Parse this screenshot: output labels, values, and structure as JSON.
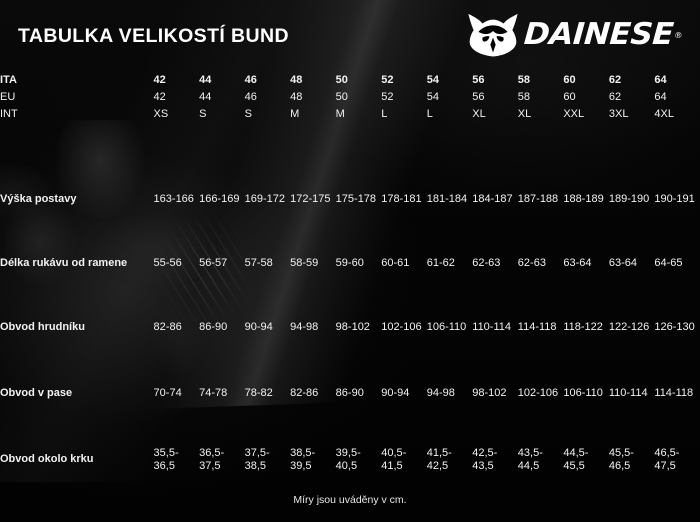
{
  "header": {
    "title": "TABULKA VELIKOSTÍ BUND",
    "brand": "DAINESE",
    "brand_reg": "®",
    "logo_icon": "dainese-devil-logo"
  },
  "footnote": "Míry jsou uváděny v cm.",
  "table": {
    "size_rows": [
      {
        "label": "ITA",
        "values": [
          "42",
          "44",
          "46",
          "48",
          "50",
          "52",
          "54",
          "56",
          "58",
          "60",
          "62",
          "64"
        ]
      },
      {
        "label": "EU",
        "values": [
          "42",
          "44",
          "46",
          "48",
          "50",
          "52",
          "54",
          "56",
          "58",
          "60",
          "62",
          "64"
        ]
      },
      {
        "label": "INT",
        "values": [
          "XS",
          "S",
          "S",
          "M",
          "M",
          "L",
          "L",
          "XL",
          "XL",
          "XXL",
          "3XL",
          "4XL"
        ]
      }
    ],
    "measure_rows": [
      {
        "label": "Výška postavy",
        "values": [
          "163-166",
          "166-169",
          "169-172",
          "172-175",
          "175-178",
          "178-181",
          "181-184",
          "184-187",
          "187-188",
          "188-189",
          "189-190",
          "190-191"
        ]
      },
      {
        "label": "Délka rukávu od ramene",
        "values": [
          "55-56",
          "56-57",
          "57-58",
          "58-59",
          "59-60",
          "60-61",
          "61-62",
          "62-63",
          "62-63",
          "63-64",
          "63-64",
          "64-65"
        ]
      },
      {
        "label": "Obvod hrudníku",
        "values": [
          "82-86",
          "86-90",
          "90-94",
          "94-98",
          "98-102",
          "102-106",
          "106-110",
          "110-114",
          "114-118",
          "118-122",
          "122-126",
          "126-130"
        ]
      },
      {
        "label": "Obvod v pase",
        "values": [
          "70-74",
          "74-78",
          "78-82",
          "82-86",
          "86-90",
          "90-94",
          "94-98",
          "98-102",
          "102-106",
          "106-110",
          "110-114",
          "114-118"
        ]
      },
      {
        "label": "Obvod okolo krku",
        "values": [
          "35,5-36,5",
          "36,5-37,5",
          "37,5-38,5",
          "38,5-39,5",
          "39,5-40,5",
          "40,5-41,5",
          "41,5-42,5",
          "42,5-43,5",
          "43,5-44,5",
          "44,5-45,5",
          "45,5-46,5",
          "46,5-47,5"
        ]
      }
    ]
  },
  "colors": {
    "background": "#040404",
    "text": "#ffffff",
    "text_muted": "#f2f2f2"
  }
}
